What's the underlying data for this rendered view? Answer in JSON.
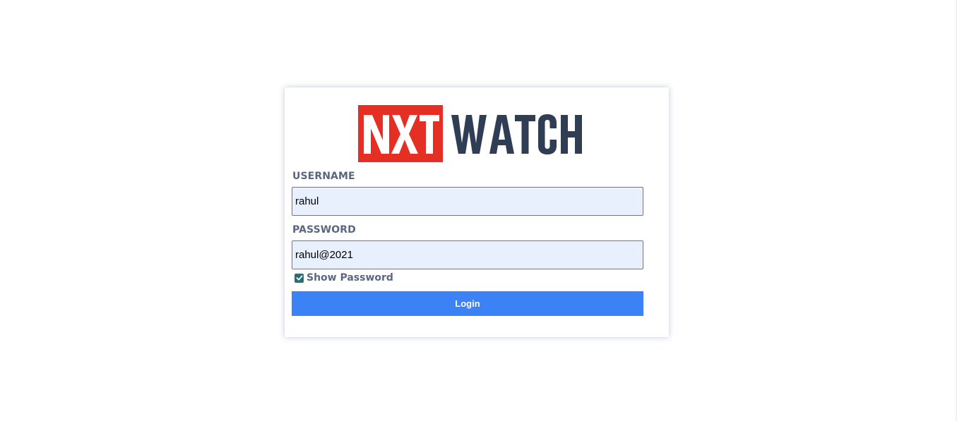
{
  "brand": {
    "logo_text_left": "NXT",
    "logo_text_right": "WATCH",
    "logo_red": "#e52f24",
    "logo_dark": "#2f3e55"
  },
  "form": {
    "username_label": "USERNAME",
    "username_value": "rahul",
    "password_label": "PASSWORD",
    "password_value": "rahul@2021",
    "show_password_label": "Show Password",
    "show_password_checked": true,
    "login_label": "Login"
  },
  "colors": {
    "input_bg": "#e8f0fe",
    "label": "#5a6782",
    "button": "#3b82f6",
    "checkbox": "#2d6c72"
  }
}
